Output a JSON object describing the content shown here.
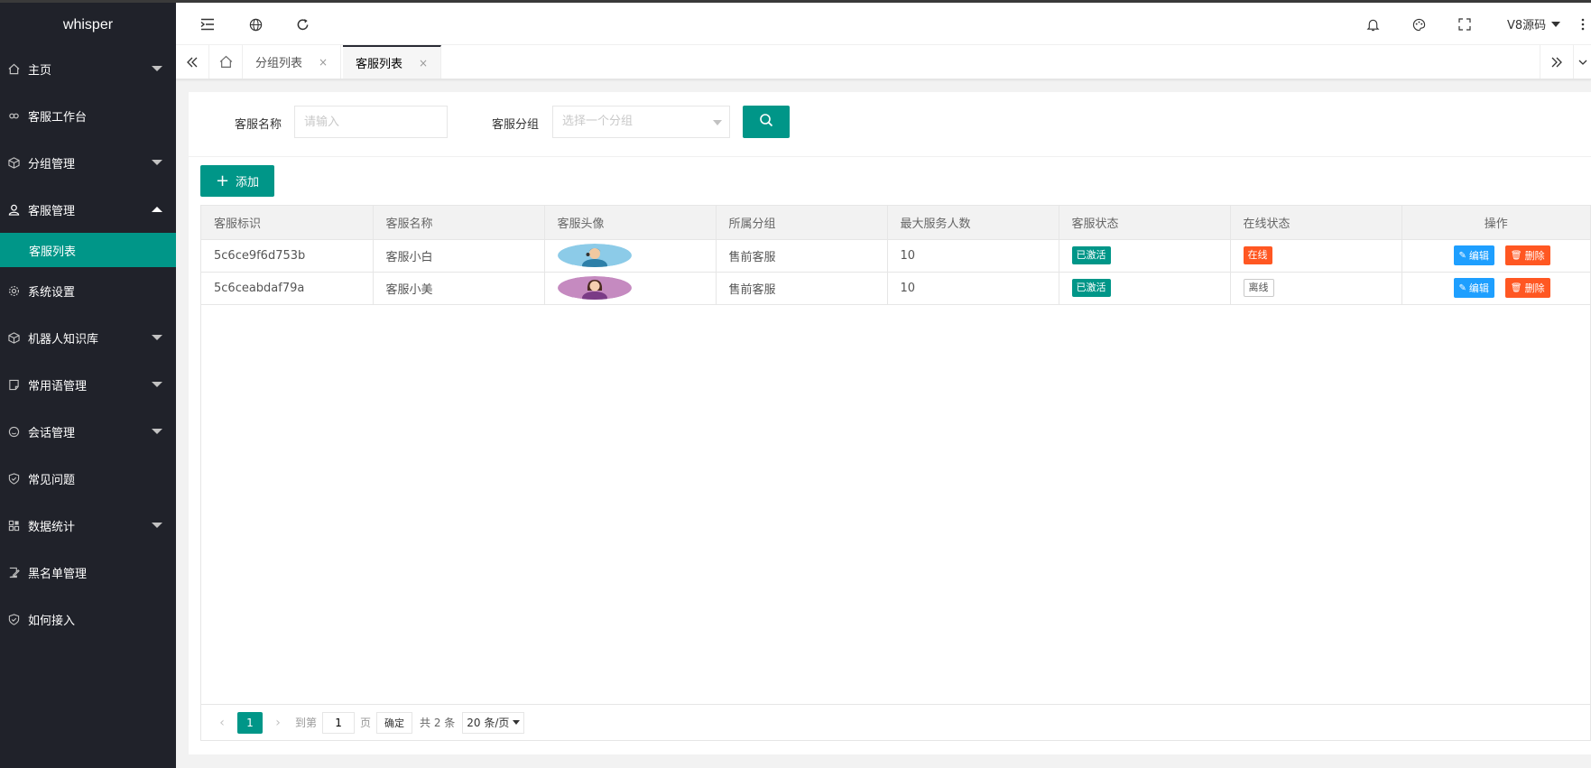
{
  "app": {
    "title": "whisper"
  },
  "colors": {
    "accent": "#009688",
    "sidebar_bg": "#20222a",
    "danger": "#ff5722",
    "info": "#1e9fff"
  },
  "sidebar": {
    "items": [
      {
        "label": "主页",
        "icon": "home-icon",
        "caret": "down"
      },
      {
        "label": "客服工作台",
        "icon": "link-icon",
        "caret": ""
      },
      {
        "label": "分组管理",
        "icon": "cube-icon",
        "caret": "down"
      },
      {
        "label": "客服管理",
        "icon": "user-icon",
        "caret": "up"
      },
      {
        "label": "系统设置",
        "icon": "gear-icon",
        "caret": ""
      },
      {
        "label": "机器人知识库",
        "icon": "cube-icon",
        "caret": "down"
      },
      {
        "label": "常用语管理",
        "icon": "note-icon",
        "caret": "down"
      },
      {
        "label": "会话管理",
        "icon": "smile-icon",
        "caret": "down"
      },
      {
        "label": "常见问题",
        "icon": "shield-icon",
        "caret": ""
      },
      {
        "label": "数据统计",
        "icon": "grid-icon",
        "caret": "down"
      },
      {
        "label": "黑名单管理",
        "icon": "edit-icon",
        "caret": ""
      },
      {
        "label": "如何接入",
        "icon": "shield-icon",
        "caret": ""
      }
    ],
    "active_sub": "客服列表"
  },
  "header": {
    "icons": [
      "menu-fold-icon",
      "globe-icon",
      "refresh-icon",
      "bell-icon",
      "palette-icon",
      "fullscreen-icon",
      "more-vertical-icon"
    ],
    "user": "V8源码"
  },
  "tabs": {
    "items": [
      {
        "label": "分组列表",
        "active": false
      },
      {
        "label": "客服列表",
        "active": true
      }
    ],
    "close_glyph": "×"
  },
  "filters": {
    "name_label": "客服名称",
    "name_placeholder": "请输入",
    "group_label": "客服分组",
    "group_placeholder": "选择一个分组"
  },
  "toolbar": {
    "add_label": "添加"
  },
  "table": {
    "columns": [
      "客服标识",
      "客服名称",
      "客服头像",
      "所属分组",
      "最大服务人数",
      "客服状态",
      "在线状态",
      "操作"
    ],
    "rows": [
      {
        "id": "5c6ce9f6d753b",
        "name": "客服小白",
        "avatar": "male-avatar",
        "group": "售前客服",
        "max": "10",
        "status": "已激活",
        "online": "在线",
        "online_state": "on"
      },
      {
        "id": "5c6ceabdaf79a",
        "name": "客服小美",
        "avatar": "female-avatar",
        "group": "售前客服",
        "max": "10",
        "status": "已激活",
        "online": "离线",
        "online_state": "off"
      }
    ],
    "edit_label": "编辑",
    "delete_label": "删除"
  },
  "pager": {
    "current": "1",
    "goto_prefix": "到第",
    "goto_value": "1",
    "goto_suffix": "页",
    "confirm": "确定",
    "total": "共 2 条",
    "page_size": "20 条/页"
  }
}
